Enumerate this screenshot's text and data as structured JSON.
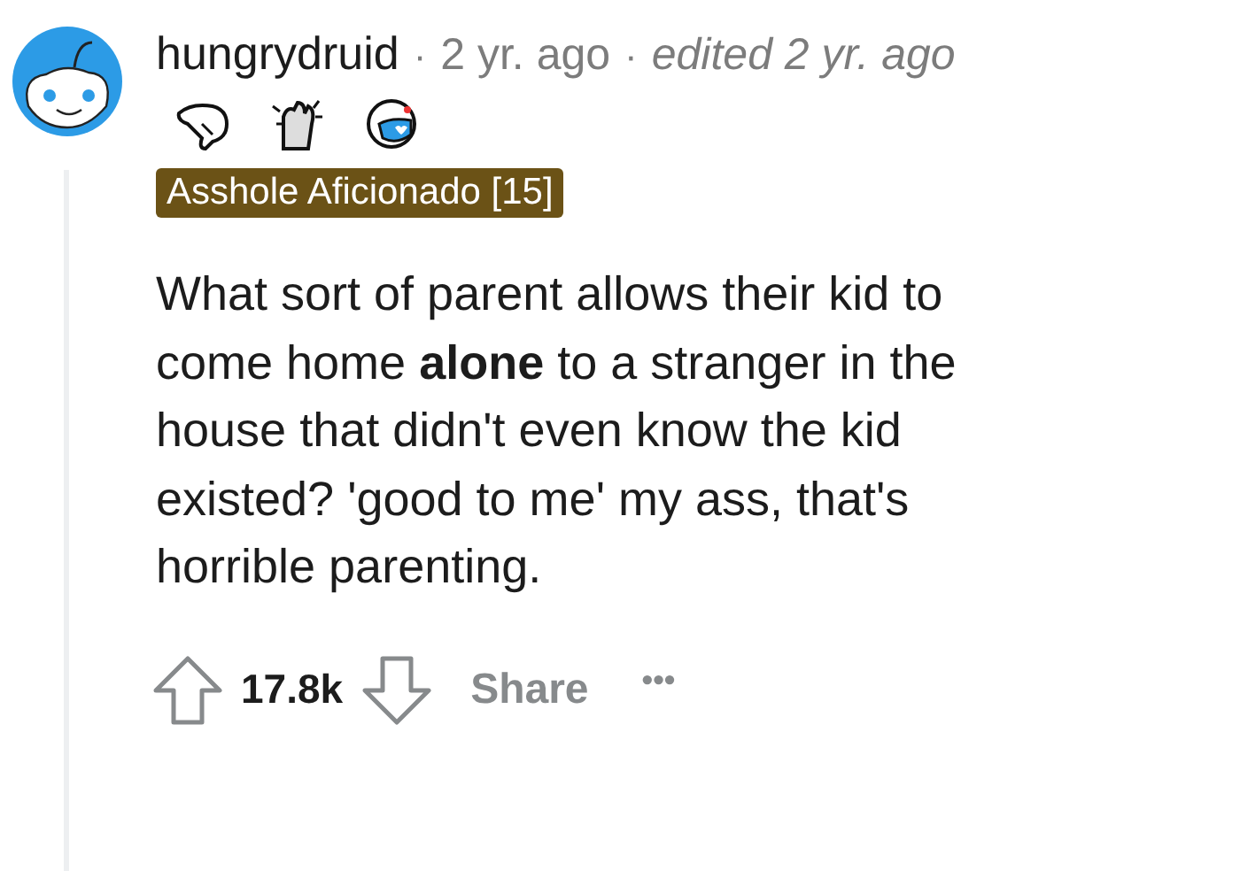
{
  "comment": {
    "author": "hungrydruid",
    "separator": "·",
    "time": "2 yr. ago",
    "separator_2": "·",
    "edited": "edited 2 yr. ago",
    "flair": "Asshole Aficionado [15]",
    "body": "What sort of parent allows their kid to come home **alone** to a stranger in the house that didn't even know the kid existed? 'good to me' my ass, that's horrible parenting.",
    "score": "17.8k",
    "share": "Share",
    "more": "•••"
  }
}
